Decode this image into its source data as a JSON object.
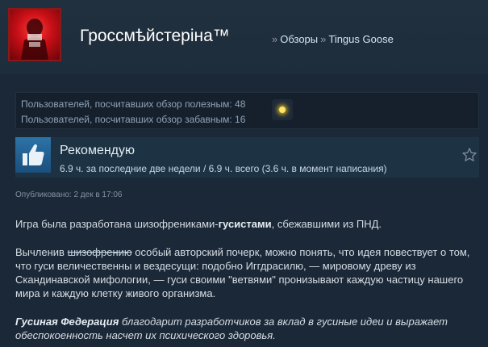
{
  "header": {
    "persona_name": "Гроссмѣйстеріна™",
    "breadcrumb": {
      "sep1": "»",
      "reviews_link": "Обзоры",
      "sep2": "»",
      "game_link": "Tingus Goose"
    }
  },
  "helpful": {
    "useful_text": "Пользователей, посчитавших обзор полезным: 48",
    "funny_text": "Пользователей, посчитавших обзор забавным: 16",
    "award_icon": "award-icon",
    "award_color": "#ffe566"
  },
  "recommendation": {
    "icon": "thumbs-up-icon",
    "title": "Рекомендую",
    "hours": "6.9 ч. за последние две недели / 6.9 ч. всего (3.6 ч. в момент написания)",
    "star_icon": "star-icon"
  },
  "posted": "Опубликовано: 2 дек в 17:06",
  "review": {
    "p1_prefix": "Игра была разработана шизофрениками-",
    "p1_bold": "гусистами",
    "p1_suffix": ", сбежавшими из ПНД.",
    "p2_prefix": "Вычленив ",
    "p2_strike": "шизофрению",
    "p2_rest": " особый авторский почерк, можно понять, что идея повествует о том, что гуси величественны и вездесущи: подобно Иггдрасилю, — мировому древу из Скандинавской мифологии, — гуси своими \"ветвями\" пронизывают каждую частицу нашего мира и каждую клетку живого организма.",
    "p3_bold_italic": "Гусиная Федерация",
    "p3_italic": " благодарит разработчиков за вклад в гусиные идеи и выражает обеспокоенность насчет их психического здоровья."
  },
  "colors": {
    "background": "#1b2838",
    "recommend_box": "#1d3344",
    "thumb_blue": "#2d73a8"
  }
}
